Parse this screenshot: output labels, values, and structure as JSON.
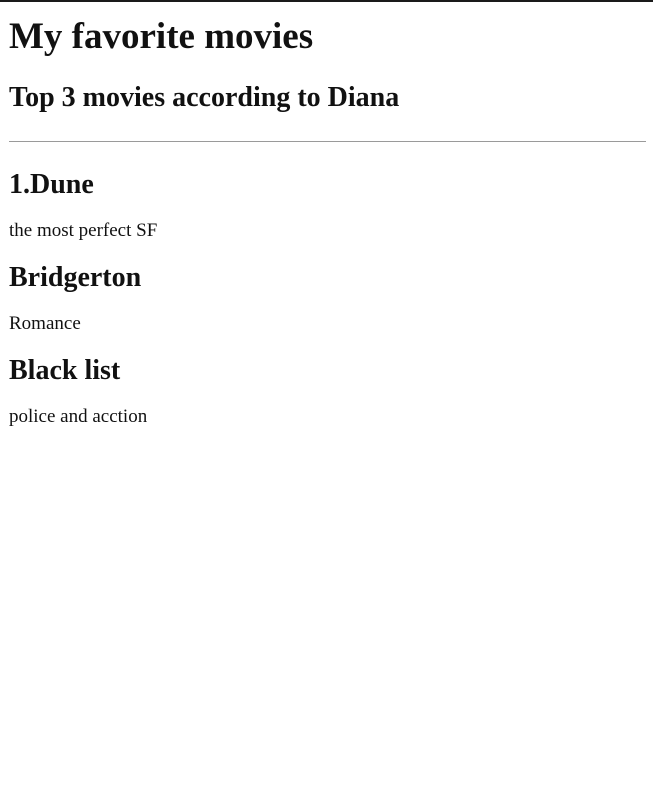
{
  "page": {
    "title": "My favorite movies",
    "subtitle": "Top 3 movies according to Diana"
  },
  "movies": [
    {
      "title": "1.Dune",
      "description": "the most perfect SF"
    },
    {
      "title": "Bridgerton",
      "description": "Romance"
    },
    {
      "title": "Black list",
      "description": "police and acction"
    }
  ]
}
